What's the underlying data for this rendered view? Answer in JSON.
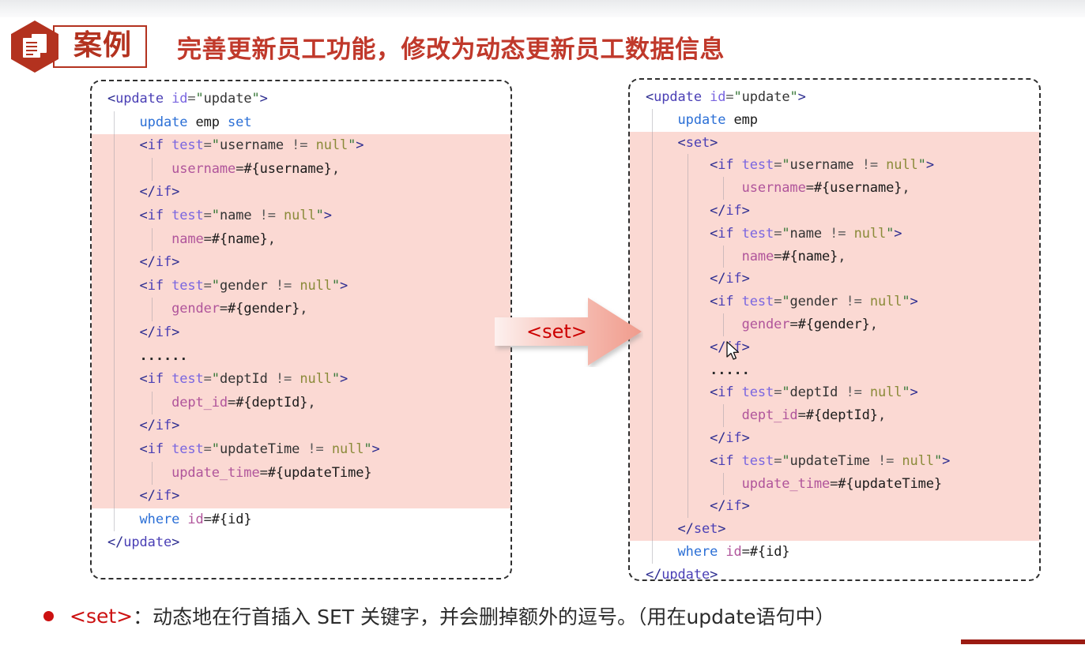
{
  "header": {
    "badge_label": "案例",
    "badge_icon": "document-hexagon-icon",
    "title": "完善更新员工功能，修改为动态更新员工数据信息",
    "accent_color": "#b3321f",
    "title_color": "#c0392b"
  },
  "arrow": {
    "label": "<set>",
    "label_color": "#cc0000",
    "direction": "right"
  },
  "left_panel": {
    "name": "before-code-block",
    "highlight_color": "#fbd9d3",
    "lines": [
      {
        "indent": 0,
        "highlight": false,
        "text": "<update id=\"update\">"
      },
      {
        "indent": 1,
        "highlight": false,
        "text": "    update emp set"
      },
      {
        "indent": 1,
        "highlight": true,
        "text": "    <if test=\"username != null\">"
      },
      {
        "indent": 2,
        "highlight": true,
        "text": "        username=#{username},"
      },
      {
        "indent": 1,
        "highlight": true,
        "text": "    </if>"
      },
      {
        "indent": 1,
        "highlight": true,
        "text": "    <if test=\"name != null\">"
      },
      {
        "indent": 2,
        "highlight": true,
        "text": "        name=#{name},"
      },
      {
        "indent": 1,
        "highlight": true,
        "text": "    </if>"
      },
      {
        "indent": 1,
        "highlight": true,
        "text": "    <if test=\"gender != null\">"
      },
      {
        "indent": 2,
        "highlight": true,
        "text": "        gender=#{gender},"
      },
      {
        "indent": 1,
        "highlight": true,
        "text": "    </if>"
      },
      {
        "indent": 1,
        "highlight": true,
        "text": "    ......"
      },
      {
        "indent": 1,
        "highlight": true,
        "text": "    <if test=\"deptId != null\">"
      },
      {
        "indent": 2,
        "highlight": true,
        "text": "        dept_id=#{deptId},"
      },
      {
        "indent": 1,
        "highlight": true,
        "text": "    </if>"
      },
      {
        "indent": 1,
        "highlight": true,
        "text": "    <if test=\"updateTime != null\">"
      },
      {
        "indent": 2,
        "highlight": true,
        "text": "        update_time=#{updateTime}"
      },
      {
        "indent": 1,
        "highlight": true,
        "text": "    </if>"
      },
      {
        "indent": 1,
        "highlight": false,
        "text": "    where id=#{id}"
      },
      {
        "indent": 0,
        "highlight": false,
        "text": "</update>"
      }
    ]
  },
  "right_panel": {
    "name": "after-code-block",
    "highlight_color": "#fbd9d3",
    "lines": [
      {
        "indent": 0,
        "highlight": false,
        "text": "<update id=\"update\">"
      },
      {
        "indent": 1,
        "highlight": false,
        "text": "    update emp"
      },
      {
        "indent": 1,
        "highlight": true,
        "text": "    <set>"
      },
      {
        "indent": 2,
        "highlight": true,
        "text": "        <if test=\"username != null\">"
      },
      {
        "indent": 3,
        "highlight": true,
        "text": "            username=#{username},"
      },
      {
        "indent": 2,
        "highlight": true,
        "text": "        </if>"
      },
      {
        "indent": 2,
        "highlight": true,
        "text": "        <if test=\"name != null\">"
      },
      {
        "indent": 3,
        "highlight": true,
        "text": "            name=#{name},"
      },
      {
        "indent": 2,
        "highlight": true,
        "text": "        </if>"
      },
      {
        "indent": 2,
        "highlight": true,
        "text": "        <if test=\"gender != null\">"
      },
      {
        "indent": 3,
        "highlight": true,
        "text": "            gender=#{gender},"
      },
      {
        "indent": 2,
        "highlight": true,
        "text": "        </if>"
      },
      {
        "indent": 2,
        "highlight": true,
        "text": "        ....."
      },
      {
        "indent": 2,
        "highlight": true,
        "text": "        <if test=\"deptId != null\">"
      },
      {
        "indent": 3,
        "highlight": true,
        "text": "            dept_id=#{deptId},"
      },
      {
        "indent": 2,
        "highlight": true,
        "text": "        </if>"
      },
      {
        "indent": 2,
        "highlight": true,
        "text": "        <if test=\"updateTime != null\">"
      },
      {
        "indent": 3,
        "highlight": true,
        "text": "            update_time=#{updateTime}"
      },
      {
        "indent": 2,
        "highlight": true,
        "text": "        </if>"
      },
      {
        "indent": 1,
        "highlight": true,
        "text": "    </set>"
      },
      {
        "indent": 1,
        "highlight": false,
        "text": "    where id=#{id}"
      },
      {
        "indent": 0,
        "highlight": false,
        "text": "</update>"
      }
    ]
  },
  "footer": {
    "bullet_code": "<set>",
    "bullet_separator": "：",
    "bullet_text": "动态地在行首插入 SET 关键字，并会删掉额外的逗号。（用在update语句中）",
    "bullet_color": "#cc1111"
  }
}
